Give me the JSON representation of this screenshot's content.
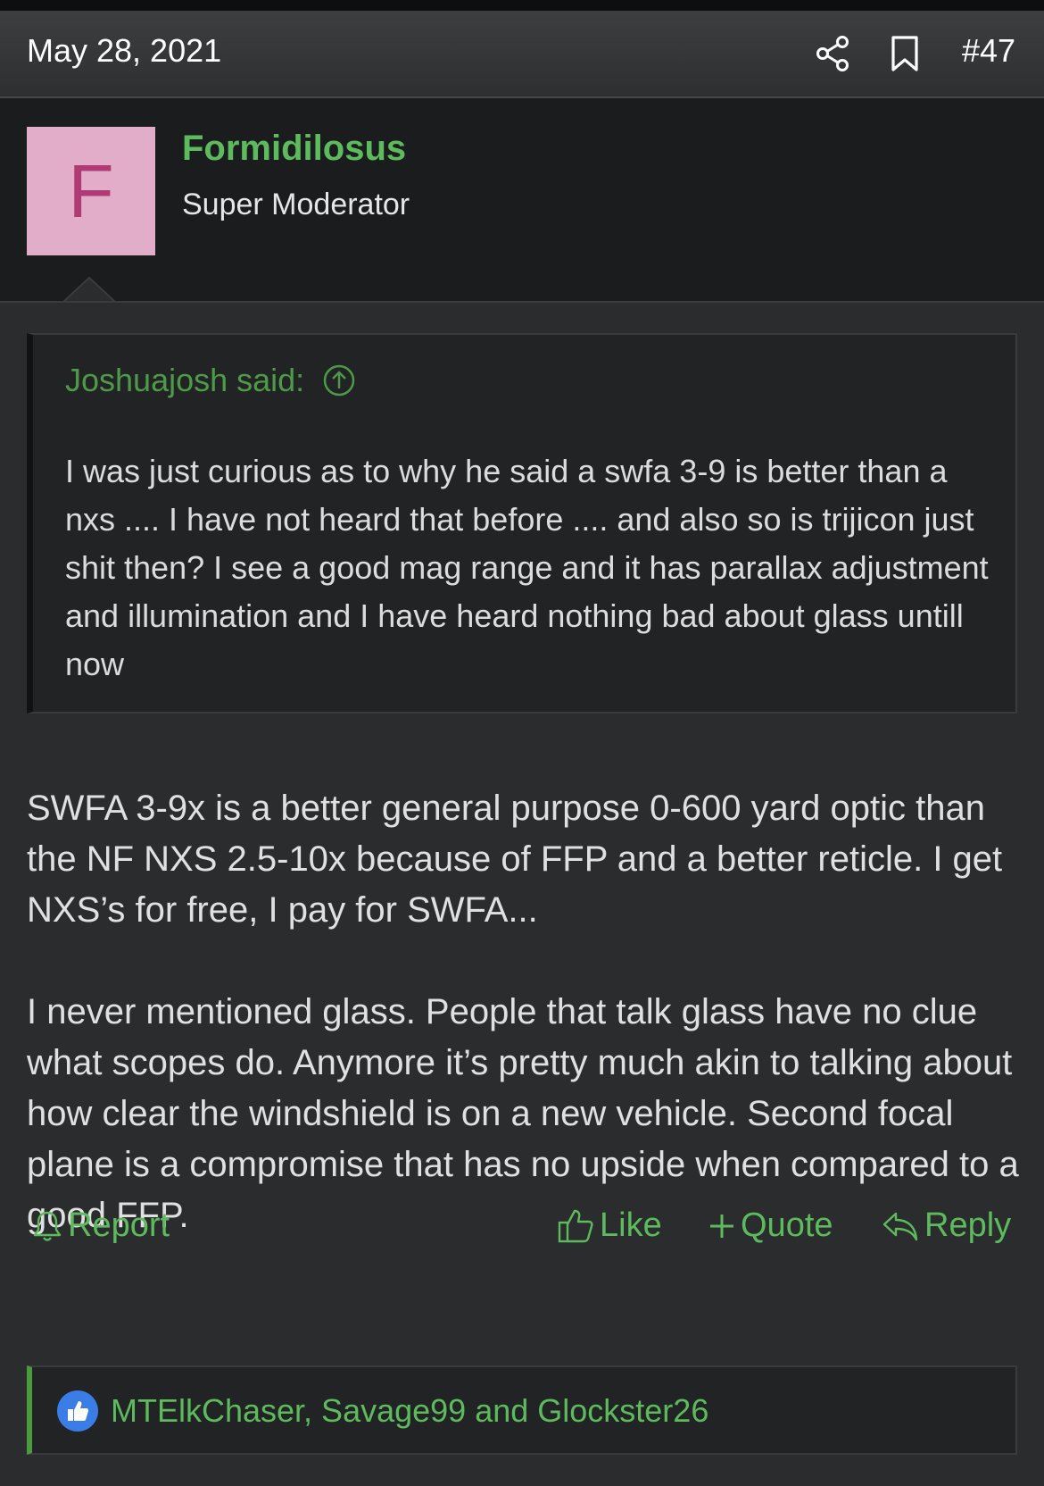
{
  "post": {
    "date": "May 28, 2021",
    "number": "#47",
    "share_icon": "share-icon",
    "bookmark_icon": "bookmark-icon"
  },
  "user": {
    "avatar_letter": "F",
    "avatar_bg": "#e2adc9",
    "avatar_fg": "#b03a73",
    "name": "Formidilosus",
    "title": "Super Moderator"
  },
  "quote": {
    "author_line": "Joshuajosh said:",
    "text": "I was just curious as to why he said a swfa 3-9 is better than a nxs .... I have not heard that before .... and also so is trijicon just shit then? I see a good mag range and it has parallax adjustment and illumination and I have heard nothing bad about glass untill now"
  },
  "message": {
    "paragraphs": [
      "SWFA 3-9x is a better general purpose 0-600 yard optic than the NF NXS 2.5-10x because of FFP and a better reticle. I get NXS’s for free, I pay for SWFA...",
      "I never mentioned glass. People that talk glass have no clue what scopes do. Anymore it’s pretty much akin to talking about how clear the windshield is on a new vehicle. Second focal plane is a compromise that has no upside when compared to a good FFP."
    ]
  },
  "actions": {
    "report": "Report",
    "like": "Like",
    "quote": "Quote",
    "reply": "Reply"
  },
  "reactions": {
    "users": "MTElkChaser, Savage99 and Glockster26"
  },
  "colors": {
    "accent_green": "#5dba5d",
    "background": "#2b2c2e",
    "header": "#3d3e40"
  }
}
